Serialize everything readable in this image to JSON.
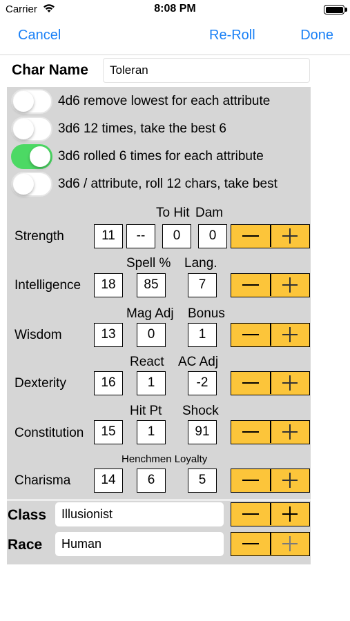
{
  "status_bar": {
    "carrier": "Carrier",
    "time": "8:08 PM"
  },
  "nav": {
    "cancel": "Cancel",
    "reroll": "Re-Roll",
    "done": "Done"
  },
  "char_name": {
    "label": "Char Name",
    "value": "Toleran"
  },
  "roll_methods": [
    {
      "label": "4d6 remove lowest for each attribute",
      "on": false
    },
    {
      "label": "3d6 12 times, take the best 6",
      "on": false
    },
    {
      "label": "3d6 rolled 6 times for each attribute",
      "on": true
    },
    {
      "label": "3d6 / attribute, roll 12 chars, take best",
      "on": false
    }
  ],
  "attributes": [
    {
      "name": "Strength",
      "headers": [
        "To Hit",
        "Dam"
      ],
      "values": [
        "11",
        "--",
        "0",
        "0"
      ]
    },
    {
      "name": "Intelligence",
      "headers": [
        "Spell %",
        "Lang."
      ],
      "values": [
        "18",
        "85",
        "7"
      ]
    },
    {
      "name": "Wisdom",
      "headers": [
        "Mag Adj",
        "Bonus"
      ],
      "values": [
        "13",
        "0",
        "1"
      ]
    },
    {
      "name": "Dexterity",
      "headers": [
        "React",
        "AC Adj"
      ],
      "values": [
        "16",
        "1",
        "-2"
      ]
    },
    {
      "name": "Constitution",
      "headers": [
        "Hit Pt",
        "Shock"
      ],
      "values": [
        "15",
        "1",
        "91"
      ]
    },
    {
      "name": "Charisma",
      "headers": [
        "Henchmen Loyalty"
      ],
      "values": [
        "14",
        "6",
        "5"
      ]
    }
  ],
  "class": {
    "label": "Class",
    "value": "Illusionist"
  },
  "race": {
    "label": "Race",
    "value": "Human"
  },
  "colors": {
    "accent": "#1a80f6",
    "stepper": "#fcc53a",
    "switch_on": "#4cd964",
    "panel": "#d6d6d6"
  }
}
